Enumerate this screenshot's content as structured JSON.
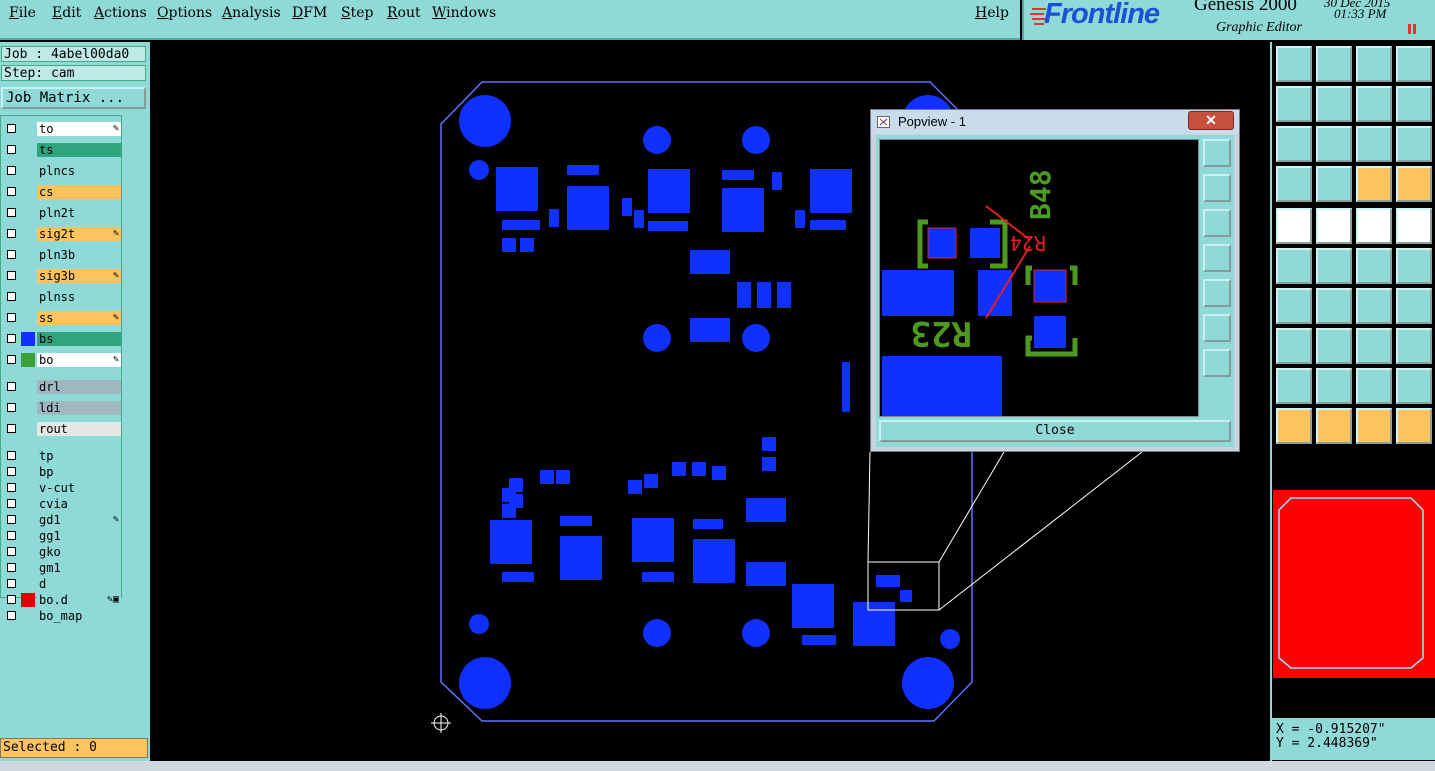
{
  "menubar": {
    "items": [
      "File",
      "Edit",
      "Actions",
      "Options",
      "Analysis",
      "DFM",
      "Step",
      "Rout",
      "Windows"
    ],
    "help": "Help"
  },
  "branding": {
    "logo": "Frontline",
    "product": "Genesis 2000",
    "subtitle": "Graphic Editor",
    "date": "30 Dec 2015",
    "time": "01:33 PM"
  },
  "left_panel": {
    "job": "Job : 4abel00da0",
    "step": "Step: cam",
    "job_matrix": "Job Matrix ...",
    "layers": [
      {
        "name": "to",
        "color": "#ffffff",
        "mark": "✎"
      },
      {
        "name": "ts",
        "color": "#2ea57c",
        "mark": ""
      },
      {
        "name": "plncs",
        "color": "#8fdad6",
        "mark": ""
      },
      {
        "name": "cs",
        "color": "#ffc35e",
        "mark": ""
      },
      {
        "name": "pln2t",
        "color": "#8fdad6",
        "mark": ""
      },
      {
        "name": "sig2t",
        "color": "#ffc35e",
        "mark": "✎"
      },
      {
        "name": "pln3b",
        "color": "#8fdad6",
        "mark": ""
      },
      {
        "name": "sig3b",
        "color": "#ffc35e",
        "mark": "✎"
      },
      {
        "name": "plnss",
        "color": "#8fdad6",
        "mark": ""
      },
      {
        "name": "ss",
        "color": "#ffc35e",
        "mark": "✎"
      },
      {
        "name": "bs",
        "color": "#2ea57c",
        "mark": ""
      },
      {
        "name": "bo",
        "color": "#ffffff",
        "mark": "✎"
      },
      {
        "name": "drl",
        "color": "#9fb7bf",
        "mark": ""
      },
      {
        "name": "ldi",
        "color": "#9fb7bf",
        "mark": ""
      },
      {
        "name": "rout",
        "color": "#e6e6e6",
        "mark": ""
      },
      {
        "name": "tp",
        "color": "#8fdad6",
        "mark": ""
      },
      {
        "name": "bp",
        "color": "#8fdad6",
        "mark": ""
      },
      {
        "name": "v-cut",
        "color": "#8fdad6",
        "mark": ""
      },
      {
        "name": "cvia",
        "color": "#8fdad6",
        "mark": ""
      },
      {
        "name": "gd1",
        "color": "#8fdad6",
        "mark": "✎"
      },
      {
        "name": "gg1",
        "color": "#8fdad6",
        "mark": ""
      },
      {
        "name": "gko",
        "color": "#8fdad6",
        "mark": ""
      },
      {
        "name": "gm1",
        "color": "#8fdad6",
        "mark": ""
      },
      {
        "name": "d",
        "color": "#8fdad6",
        "mark": ""
      },
      {
        "name": "bo.d",
        "color": "#8fdad6",
        "mark": "✎▣"
      },
      {
        "name": "bo_map",
        "color": "#8fdad6",
        "mark": ""
      }
    ],
    "selected": "Selected : 0"
  },
  "popview": {
    "title": "Popview - 1",
    "close": "Close",
    "labels": {
      "r23": "R23",
      "r24": "R24",
      "b48": "B48"
    }
  },
  "coords": {
    "x": "X = -0.915207\"",
    "y": "Y = 2.448369\""
  },
  "colors": {
    "panel": "#8fdad6",
    "pad": "#1030ff",
    "highlight": "#ff0000",
    "orange": "#ffc35e",
    "silkscreen": "#2ea57c"
  }
}
